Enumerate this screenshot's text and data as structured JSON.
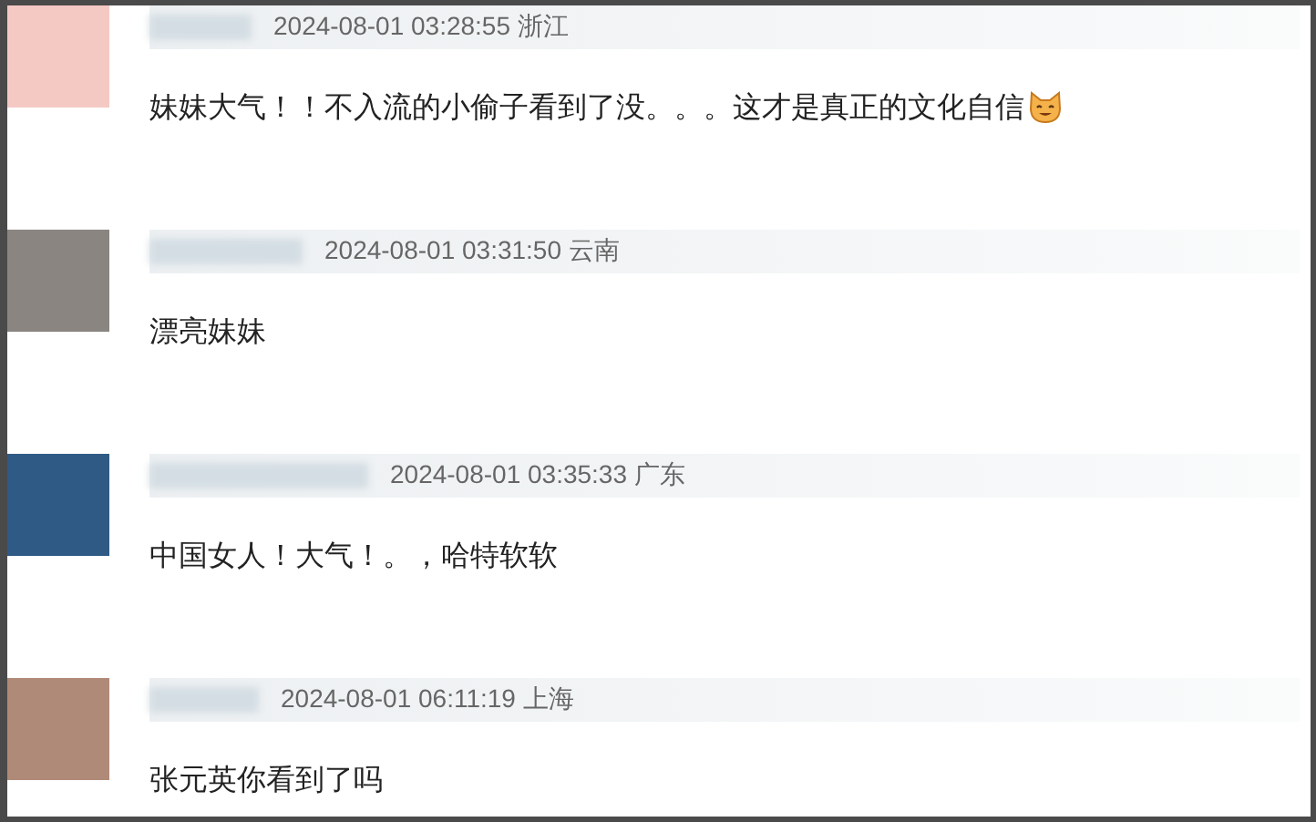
{
  "comments": [
    {
      "time": "2024-08-01 03:28:55",
      "location": "浙江",
      "text": "妹妹大气！！不入流的小偷子看到了没。。。这才是真正的文化自信",
      "emoji": true
    },
    {
      "time": "2024-08-01 03:31:50",
      "location": "云南",
      "text": "漂亮妹妹",
      "emoji": false
    },
    {
      "time": "2024-08-01 03:35:33",
      "location": "广东",
      "text": "中国女人！大气！。，哈特软软",
      "emoji": false
    },
    {
      "time": "2024-08-01 06:11:19",
      "location": "上海",
      "text": "张元英你看到了吗",
      "emoji": false
    }
  ]
}
